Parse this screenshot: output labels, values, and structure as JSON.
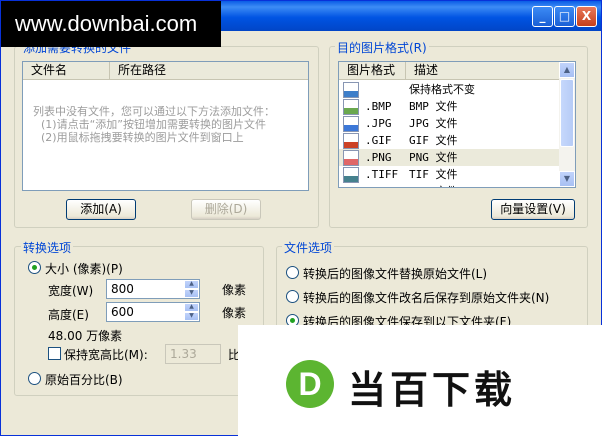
{
  "titlebar": {
    "watermark": "www.downbai.com",
    "buttons": [
      "_",
      "□",
      "X"
    ]
  },
  "file_list": {
    "group_title": "添加需要转换的文件",
    "columns": [
      "文件名",
      "所在路径"
    ],
    "empty_hint": [
      "列表中没有文件，您可以通过以下方法添加文件：",
      "(1)请点击“添加”按钮增加需要转换的图片文件",
      "(2)用鼠标拖拽要转换的图片文件到窗口上"
    ],
    "add_button": "添加(A)",
    "remove_button": "删除(D)"
  },
  "format_panel": {
    "group_title": "目的图片格式(R)",
    "columns": [
      "图片格式",
      "描述"
    ],
    "rows": [
      {
        "format": "",
        "desc": "保持格式不变",
        "icon": "keep-format-icon",
        "color": "#3d7ec9"
      },
      {
        "format": ".BMP",
        "desc": "BMP 文件",
        "icon": "bmp-file-icon",
        "color": "#6aa84f"
      },
      {
        "format": ".JPG",
        "desc": "JPG 文件",
        "icon": "jpg-file-icon",
        "color": "#3c78d8"
      },
      {
        "format": ".GIF",
        "desc": "GIF 文件",
        "icon": "gif-file-icon",
        "color": "#cc4125"
      },
      {
        "format": ".PNG",
        "desc": "PNG 文件",
        "icon": "png-file-icon",
        "color": "#e06666"
      },
      {
        "format": ".TIFF",
        "desc": "TIF 文件",
        "icon": "tiff-file-icon",
        "color": "#45818e"
      }
    ],
    "partial_row": {
      "format": ".TGA",
      "desc": "TGA 文件"
    },
    "selected_index": 4,
    "vector_button": "向量设置(V)"
  },
  "convert_options": {
    "group_title": "转换选项",
    "size_radio": "大小 (像素)(P)",
    "width_label": "宽度(W)",
    "width_value": "800",
    "height_label": "高度(E)",
    "height_value": "600",
    "unit": "像素",
    "megapixels": "48.00 万像素",
    "keep_ratio": "保持宽高比(M):",
    "ratio_value": "1.33",
    "ratio_suffix": "比",
    "percent_radio": "原始百分比(B)"
  },
  "file_options": {
    "group_title": "文件选项",
    "opt1": "转换后的图像文件替换原始文件(L)",
    "opt2": "转换后的图像文件改名后保存到原始文件夹(N)",
    "opt3": "转换后的图像文件保存到以下文件夹(F)"
  },
  "brand_logo": {
    "letter": "D",
    "text": "当百下载",
    "accent": "#5cb531"
  }
}
